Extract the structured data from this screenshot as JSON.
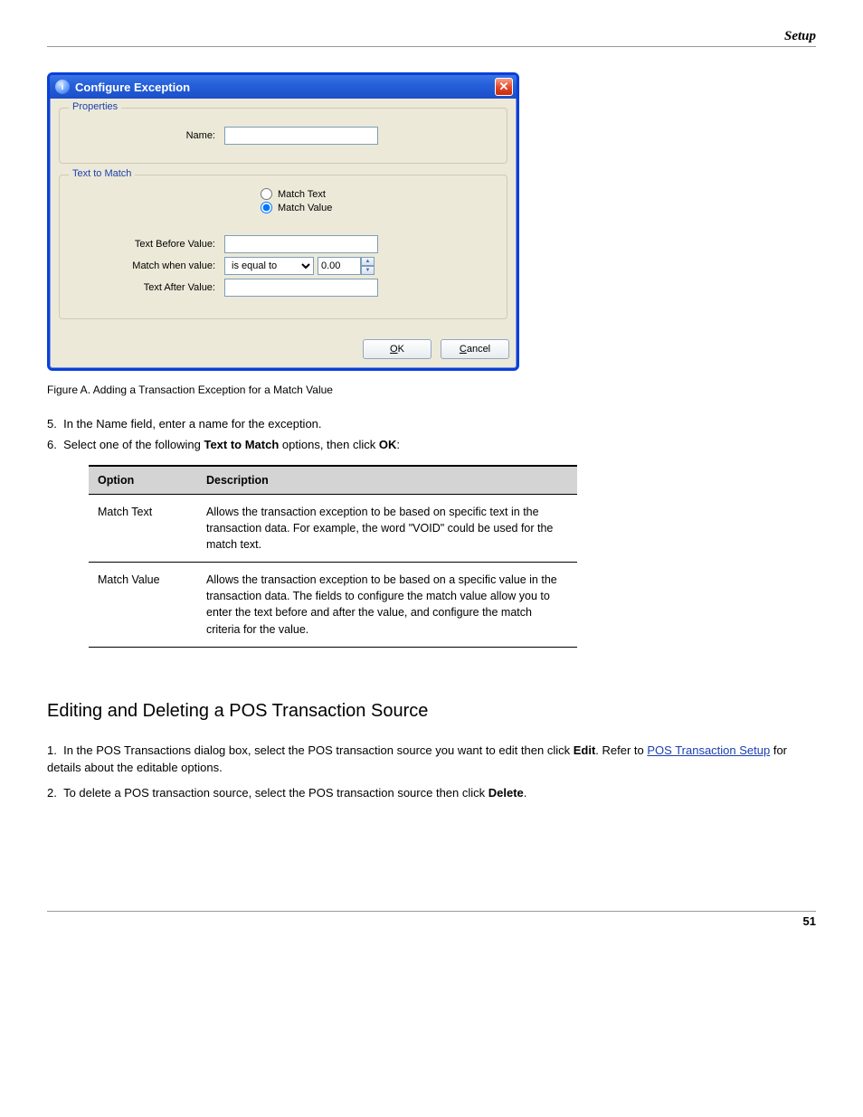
{
  "header": {
    "section": "Setup"
  },
  "figure_caption": "Figure A.  Adding a Transaction Exception for a Match Value",
  "dialog": {
    "title": "Configure Exception",
    "group_properties": {
      "legend": "Properties",
      "name_label": "Name:",
      "name_value": ""
    },
    "group_text": {
      "legend": "Text to Match",
      "radio_text": "Match Text",
      "radio_value": "Match Value",
      "before_label": "Text Before Value:",
      "before_value": "",
      "when_label": "Match when value:",
      "when_operator": "is equal to",
      "when_number": "0.00",
      "after_label": "Text After Value:",
      "after_value": ""
    },
    "buttons": {
      "ok": "OK",
      "cancel": "Cancel"
    }
  },
  "step5": "In the Name field, enter a name for the exception.",
  "step6a": "Select one of the following ",
  "step6b": "Text to Match",
  "step6c": " options, then click ",
  "step6d": "OK",
  "step6e": ":",
  "table": {
    "h1": "Option",
    "h2": "Description",
    "r1c1": "Match Text",
    "r1c2": "Allows the transaction exception to be based on specific text in the transaction data. For example, the word \"VOID\" could be used for the match text.",
    "r2c1": "Match Value",
    "r2c2": "Allows the transaction exception to be based on a specific value in the transaction data. The fields to configure the match value allow you to enter the text before and after the value, and configure the match criteria for the value."
  },
  "section_heading": "Editing and Deleting a POS Transaction Source",
  "p1a": "In the POS Transactions dialog box, select the POS transaction source you want to edit then click ",
  "p1b": "Edit",
  "p1c": ". Refer to ",
  "link_text": "POS Transaction Setup",
  "p1d": " for details about the editable options.",
  "p2a": "To delete a POS transaction source, select the POS transaction source then click ",
  "p2b": "Delete",
  "p2c": ".",
  "footer_page": "51"
}
